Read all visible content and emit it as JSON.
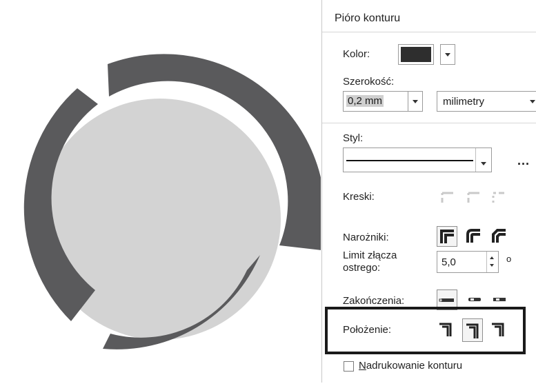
{
  "panel": {
    "title": "Pióro konturu",
    "color": {
      "label": "Kolor:",
      "swatch": "#2e2e2e"
    },
    "width": {
      "label": "Szerokość:",
      "value": "0,2 mm",
      "unit": "milimetry"
    },
    "style": {
      "label": "Styl:",
      "more": "..."
    },
    "dashes": {
      "label": "Kreski:"
    },
    "corners": {
      "label": "Narożniki:"
    },
    "miter": {
      "label_line1": "Limit złącza",
      "label_line2": "ostrego:",
      "value": "5,0",
      "unit": "o"
    },
    "line_caps": {
      "label": "Zakończenia:"
    },
    "position": {
      "label": "Położenie:"
    },
    "overprint": {
      "label_first": "N",
      "label_rest": "adrukowanie konturu",
      "checked": false
    }
  },
  "colors": {
    "ring_dark": "#5a5a5c",
    "fill_light": "#d3d3d3",
    "highlight": "#1a1a1a"
  }
}
